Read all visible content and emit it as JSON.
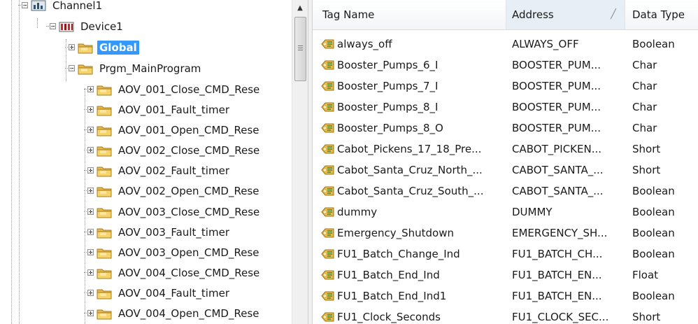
{
  "tree": {
    "nodes": [
      {
        "label": "Channel1",
        "icon": "channel-icon",
        "expander": "minus"
      },
      {
        "label": "Device1",
        "icon": "device-icon",
        "expander": "minus"
      },
      {
        "label": "Global",
        "icon": "folder-icon",
        "expander": "plus",
        "selected": true
      },
      {
        "label": "Prgm_MainProgram",
        "icon": "folder-icon",
        "expander": "minus"
      },
      {
        "label": "AOV_001_Close_CMD_Rese",
        "icon": "folder-icon",
        "expander": "plus"
      },
      {
        "label": "AOV_001_Fault_timer",
        "icon": "folder-icon",
        "expander": "plus"
      },
      {
        "label": "AOV_001_Open_CMD_Rese",
        "icon": "folder-icon",
        "expander": "plus"
      },
      {
        "label": "AOV_002_Close_CMD_Rese",
        "icon": "folder-icon",
        "expander": "plus"
      },
      {
        "label": "AOV_002_Fault_timer",
        "icon": "folder-icon",
        "expander": "plus"
      },
      {
        "label": "AOV_002_Open_CMD_Rese",
        "icon": "folder-icon",
        "expander": "plus"
      },
      {
        "label": "AOV_003_Close_CMD_Rese",
        "icon": "folder-icon",
        "expander": "plus"
      },
      {
        "label": "AOV_003_Fault_timer",
        "icon": "folder-icon",
        "expander": "plus"
      },
      {
        "label": "AOV_003_Open_CMD_Rese",
        "icon": "folder-icon",
        "expander": "plus"
      },
      {
        "label": "AOV_004_Close_CMD_Rese",
        "icon": "folder-icon",
        "expander": "plus"
      },
      {
        "label": "AOV_004_Fault_timer",
        "icon": "folder-icon",
        "expander": "plus"
      },
      {
        "label": "AOV_004_Open_CMD_Rese",
        "icon": "folder-icon",
        "expander": "plus"
      }
    ]
  },
  "table": {
    "columns": [
      {
        "label": "Tag Name"
      },
      {
        "label": "Address"
      },
      {
        "label": "Data Type"
      }
    ],
    "rows": [
      {
        "name": "always_off",
        "address": "ALWAYS_OFF",
        "type": "Boolean"
      },
      {
        "name": "Booster_Pumps_6_I",
        "address": "BOOSTER_PUM...",
        "type": "Char"
      },
      {
        "name": "Booster_Pumps_7_I",
        "address": "BOOSTER_PUM...",
        "type": "Char"
      },
      {
        "name": "Booster_Pumps_8_I",
        "address": "BOOSTER_PUM...",
        "type": "Char"
      },
      {
        "name": "Booster_Pumps_8_O",
        "address": "BOOSTER_PUM...",
        "type": "Char"
      },
      {
        "name": "Cabot_Pickens_17_18_Pre...",
        "address": "CABOT_PICKEN...",
        "type": "Short"
      },
      {
        "name": "Cabot_Santa_Cruz_North_...",
        "address": "CABOT_SANTA_...",
        "type": "Short"
      },
      {
        "name": "Cabot_Santa_Cruz_South_...",
        "address": "CABOT_SANTA_...",
        "type": "Boolean"
      },
      {
        "name": "dummy",
        "address": "DUMMY",
        "type": "Boolean"
      },
      {
        "name": "Emergency_Shutdown",
        "address": "EMERGENCY_SH...",
        "type": "Boolean"
      },
      {
        "name": "FU1_Batch_Change_Ind",
        "address": "FU1_BATCH_CH...",
        "type": "Boolean"
      },
      {
        "name": "FU1_Batch_End_Ind",
        "address": "FU1_BATCH_EN...",
        "type": "Float"
      },
      {
        "name": "FU1_Batch_End_Ind1",
        "address": "FU1_BATCH_EN...",
        "type": "Boolean"
      },
      {
        "name": "FU1_Clock_Seconds",
        "address": "FU1_CLOCK_SEC...",
        "type": "Short"
      }
    ]
  },
  "icons": {
    "tag": "tag-icon",
    "sort": "sort-indicator-icon",
    "scroll_up": "scroll-up-arrow-icon"
  },
  "colors": {
    "selection": "#3399ff",
    "folder": "#f2c94c",
    "tag_icon": "#e6b94a"
  }
}
